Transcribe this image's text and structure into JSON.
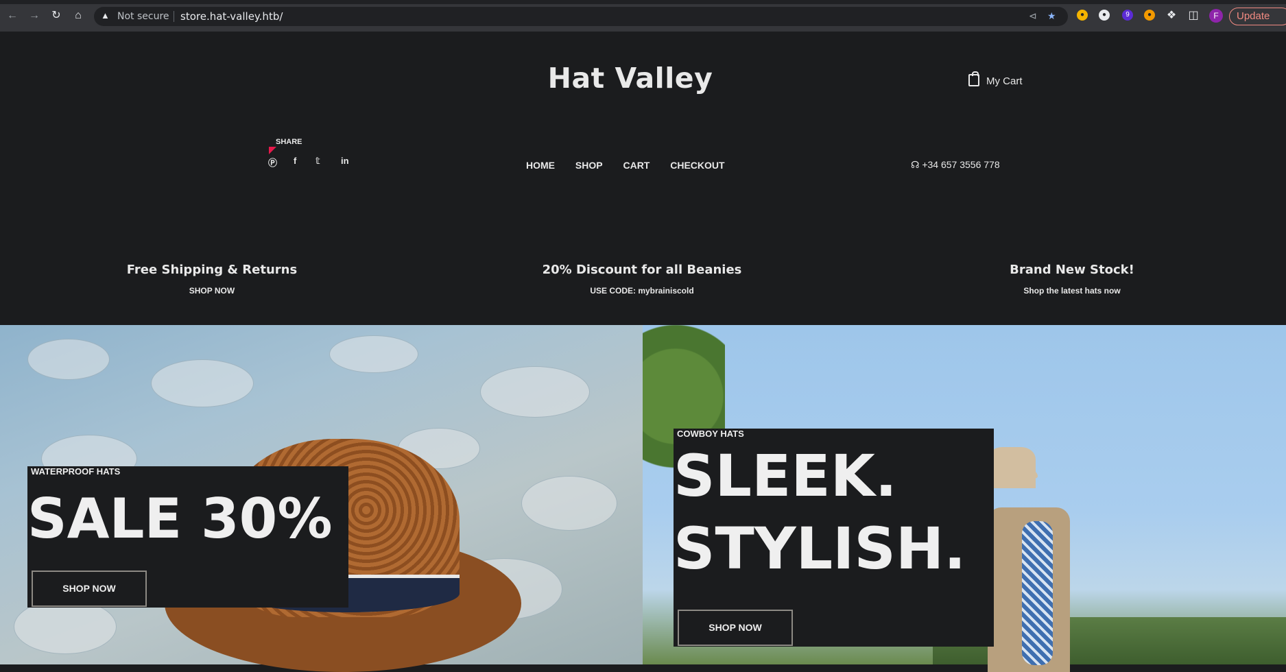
{
  "browser": {
    "url_warning": "Not secure",
    "url": "store.hat-valley.htb/",
    "update_label": "Update",
    "avatar_letter": "F",
    "extension_badge": "9"
  },
  "header": {
    "brand": "Hat Valley",
    "cart_label": "My Cart",
    "share_label": "SHARE",
    "phone": "+34 657 3556 778"
  },
  "menu": [
    "HOME",
    "SHOP",
    "CART",
    "CHECKOUT"
  ],
  "promos": [
    {
      "title": "Free Shipping & Returns",
      "sub": "SHOP NOW"
    },
    {
      "title": "20% Discount for all Beanies",
      "sub": "USE CODE: mybrainiscold"
    },
    {
      "title": "Brand New Stock!",
      "sub": "Shop the latest hats now"
    }
  ],
  "banners": {
    "left": {
      "kicker": "WATERPROOF HATS",
      "headline": "SALE 30%",
      "button": "SHOP NOW"
    },
    "right": {
      "kicker": "COWBOY HATS",
      "line1": "SLEEK.",
      "line2": "STYLISH.",
      "button": "SHOP NOW"
    }
  }
}
